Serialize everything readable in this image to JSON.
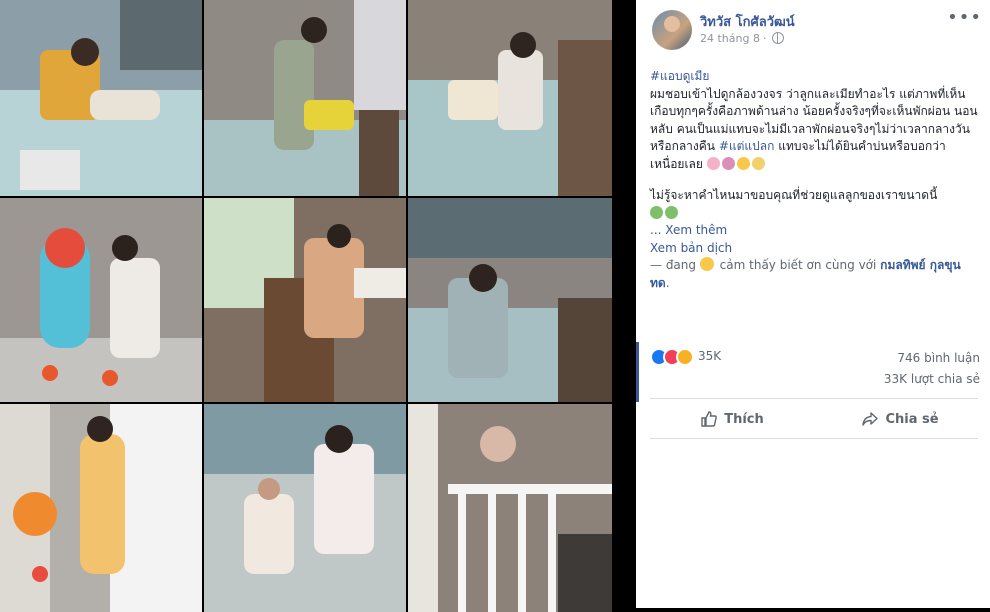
{
  "post": {
    "author": "วิทวัส โกศัลวัฒน์",
    "date": "24 tháng 8",
    "separator": "·",
    "more_label": "•••",
    "hashtag1": "#แอบดูเมีย",
    "text1": "ผมชอบเข้าไปดูกล้องวงจร ว่าลูกและเมียทำอะไร แต่ภาพที่เห็นเกือบทุกๆครั้งคือภาพด้านล่าง น้อยครั้งจริงๆที่จะเห็นพักผ่อน นอนหลับ คนเป็นแม่แทบจะไม่มีเวลาพักผ่อนจริงๆไม่ว่าเวลากลางวันหรือกลางคืน",
    "hashtag2": "#แต่แปลก",
    "text2": " แทบจะไม่ได้ยินคำบ่นหรือบอกว่าเหนื่อยเลย",
    "text3": "ไม่รู้จะหาคำไหนมาขอบคุณที่ช่วยดูแลลูกของเราขนาดนี้",
    "see_more": "... Xem thêm",
    "translate": "Xem bản dịch",
    "feeling_prefix": "— đang",
    "feeling_text": "cảm thấy biết ơn cùng với",
    "feeling_tag": "กมลทิพย์ กุลขุนทด",
    "feeling_end": "."
  },
  "stats": {
    "reaction_count": "35K",
    "comments": "746 bình luận",
    "shares": "33K lượt chia sẻ"
  },
  "actions": {
    "like": "Thích",
    "share": "Chia sẻ"
  },
  "colors": {
    "link": "#385898",
    "muted": "#606770",
    "like_blue": "#1877f2",
    "love_red": "#f33e58",
    "wow_yellow": "#f7b125"
  }
}
